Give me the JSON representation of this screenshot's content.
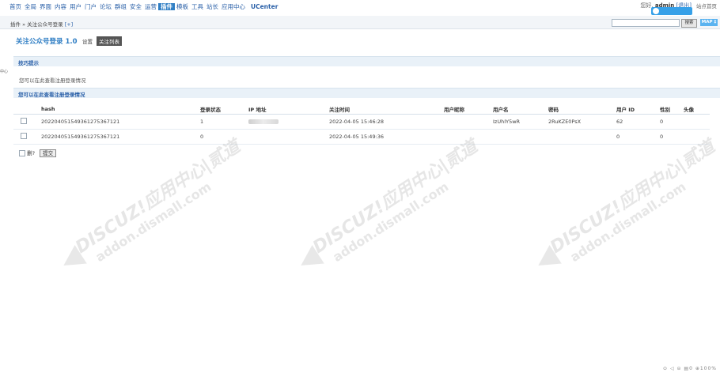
{
  "nav": {
    "items": [
      "首页",
      "全局",
      "界面",
      "内容",
      "用户",
      "门户",
      "论坛",
      "群组",
      "安全",
      "运营",
      "插件",
      "模板",
      "工具",
      "站长",
      "应用中心"
    ],
    "ucenter": "UCenter",
    "active_index": 10
  },
  "user": {
    "greeting": "您好,",
    "name": "admin",
    "logout": "[退出]",
    "site_home": "站点首页"
  },
  "subbar": {
    "breadcrumb": "插件 » 关注公众号登录",
    "add": "[+]",
    "search_btn": "搜索",
    "map_btn": "MAP ‡"
  },
  "left_edge": "中心",
  "page": {
    "title": "关注公众号登录 1.0",
    "settings": "设置",
    "tag": "关注列表"
  },
  "tips": {
    "head": "技巧提示",
    "text": "您可以在此查看注册登录情况"
  },
  "list": {
    "head": "您可以在此查看注册登录情况",
    "columns": [
      "hash",
      "登录状态",
      "IP 地址",
      "关注时间",
      "用户昵称",
      "用户名",
      "密码",
      "用户 ID",
      "性别",
      "头像"
    ],
    "rows": [
      {
        "hash": "20220405154936127536712​1",
        "status": "1",
        "ip": "",
        "time": "2022-04-05 15:46:28",
        "nickname": "",
        "username": "IzUhIY5wR",
        "password": "2RuKZE0PsX",
        "uid": "62",
        "gender": "0",
        "avatar": ""
      },
      {
        "hash": "20220405154936127536712​1",
        "status": "0",
        "ip": "",
        "time": "2022-04-05 15:49:36",
        "nickname": "",
        "username": "",
        "password": "",
        "uid": "0",
        "gender": "0",
        "avatar": ""
      }
    ],
    "delete_label": "删?",
    "submit": "提交"
  },
  "watermark": {
    "line1": "DISCUZ!应用中心|贰道",
    "line2": "addon.dismall.com"
  },
  "status": "⊙ ◁ ⊝ ▤0 ⊕100%",
  "colors": {
    "accent": "#2f7ec4",
    "section_bg": "#e9f1f8",
    "badge": "#36a0e8"
  }
}
